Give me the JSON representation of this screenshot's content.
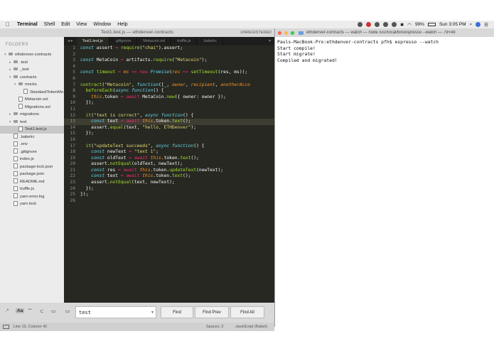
{
  "menubar": {
    "app": "Terminal",
    "items": [
      "Shell",
      "Edit",
      "View",
      "Window",
      "Help"
    ],
    "battery": "99%",
    "clock": "Sun 3:05 PM"
  },
  "editor": {
    "window_title": "Test1.test.js — ethdenver-contracts",
    "badge": "UNREGISTERED",
    "tabs": [
      "Test1.test.js",
      ".gitignore",
      "Metacoin.sol",
      "truffle.js",
      ".babelrc"
    ],
    "sidebar_header": "FOLDERS",
    "tree": [
      {
        "label": "ethdenver-contracts",
        "depth": 0,
        "kind": "folder",
        "open": true
      },
      {
        "label": ".test",
        "depth": 1,
        "kind": "folder"
      },
      {
        "label": "_test",
        "depth": 1,
        "kind": "folder"
      },
      {
        "label": "contracts",
        "depth": 1,
        "kind": "folder",
        "open": true
      },
      {
        "label": "mocks",
        "depth": 2,
        "kind": "folder",
        "open": true
      },
      {
        "label": "StandardTokenMo",
        "depth": 3,
        "kind": "file"
      },
      {
        "label": "Metacoin.sol",
        "depth": 2,
        "kind": "file"
      },
      {
        "label": "Migrations.sol",
        "depth": 2,
        "kind": "file"
      },
      {
        "label": "migrations",
        "depth": 1,
        "kind": "folder"
      },
      {
        "label": "test",
        "depth": 1,
        "kind": "folder",
        "open": true
      },
      {
        "label": "Test1.test.js",
        "depth": 2,
        "kind": "file",
        "selected": true
      },
      {
        "label": ".babelrc",
        "depth": 1,
        "kind": "file"
      },
      {
        "label": ".env",
        "depth": 1,
        "kind": "file"
      },
      {
        "label": ".gitignore",
        "depth": 1,
        "kind": "file"
      },
      {
        "label": "index.js",
        "depth": 1,
        "kind": "file"
      },
      {
        "label": "package-lock.json",
        "depth": 1,
        "kind": "file"
      },
      {
        "label": "package.json",
        "depth": 1,
        "kind": "file"
      },
      {
        "label": "README.md",
        "depth": 1,
        "kind": "file"
      },
      {
        "label": "truffle.js",
        "depth": 1,
        "kind": "file"
      },
      {
        "label": "yarn-error.log",
        "depth": 1,
        "kind": "file"
      },
      {
        "label": "yarn.lock",
        "depth": 1,
        "kind": "file"
      }
    ],
    "current_line": 13,
    "code_lines": [
      [
        [
          "kw",
          "const"
        ],
        [
          "t",
          " assert "
        ],
        [
          "red",
          "="
        ],
        [
          "t",
          " "
        ],
        [
          "fn",
          "require"
        ],
        [
          "t",
          "("
        ],
        [
          "str",
          "\"chai\""
        ],
        [
          "t",
          ").assert;"
        ]
      ],
      [],
      [
        [
          "kw",
          "const"
        ],
        [
          "t",
          " MetaCoin "
        ],
        [
          "red",
          "="
        ],
        [
          "t",
          " artifacts."
        ],
        [
          "fn",
          "require"
        ],
        [
          "t",
          "("
        ],
        [
          "str",
          "\"Metacoin\""
        ],
        [
          "t",
          ");"
        ]
      ],
      [],
      [
        [
          "kw",
          "const"
        ],
        [
          "t",
          " "
        ],
        [
          "fn",
          "timeout"
        ],
        [
          "t",
          " "
        ],
        [
          "red",
          "="
        ],
        [
          "t",
          " "
        ],
        [
          "prm",
          "ms"
        ],
        [
          "t",
          " "
        ],
        [
          "red",
          "=>"
        ],
        [
          "t",
          " "
        ],
        [
          "red",
          "new"
        ],
        [
          "t",
          " "
        ],
        [
          "kw",
          "Promise"
        ],
        [
          "t",
          "("
        ],
        [
          "prm",
          "res"
        ],
        [
          "t",
          " "
        ],
        [
          "red",
          "=>"
        ],
        [
          "t",
          " "
        ],
        [
          "fn",
          "setTimeout"
        ],
        [
          "t",
          "(res, ms));"
        ]
      ],
      [],
      [
        [
          "fn",
          "contract"
        ],
        [
          "t",
          "("
        ],
        [
          "str",
          "\"Metacoin\""
        ],
        [
          "t",
          ", "
        ],
        [
          "kw",
          "function"
        ],
        [
          "t",
          "([_, "
        ],
        [
          "prm",
          "owner"
        ],
        [
          "t",
          ", "
        ],
        [
          "prm",
          "recipient"
        ],
        [
          "t",
          ", "
        ],
        [
          "prm",
          "anotherAcco"
        ]
      ],
      [
        [
          "t",
          "  "
        ],
        [
          "fn",
          "beforeEach"
        ],
        [
          "t",
          "("
        ],
        [
          "kw",
          "async"
        ],
        [
          "t",
          " "
        ],
        [
          "kw",
          "function"
        ],
        [
          "t",
          "() {"
        ]
      ],
      [
        [
          "t",
          "    "
        ],
        [
          "ths",
          "this"
        ],
        [
          "t",
          ".token "
        ],
        [
          "red",
          "="
        ],
        [
          "t",
          " "
        ],
        [
          "red",
          "await"
        ],
        [
          "t",
          " MetaCoin."
        ],
        [
          "fn",
          "new"
        ],
        [
          "t",
          "({ owner: owner });"
        ]
      ],
      [
        [
          "t",
          "  });"
        ]
      ],
      [],
      [
        [
          "t",
          "  "
        ],
        [
          "fn",
          "it"
        ],
        [
          "t",
          "("
        ],
        [
          "str",
          "\"text is correct\""
        ],
        [
          "t",
          ", "
        ],
        [
          "kw",
          "async"
        ],
        [
          "t",
          " "
        ],
        [
          "kw",
          "function"
        ],
        [
          "t",
          "() {"
        ]
      ],
      [
        [
          "t",
          "    "
        ],
        [
          "kw",
          "const"
        ],
        [
          "t",
          " text "
        ],
        [
          "red",
          "="
        ],
        [
          "t",
          " "
        ],
        [
          "red",
          "await"
        ],
        [
          "t",
          " "
        ],
        [
          "ths",
          "this"
        ],
        [
          "t",
          ".token."
        ],
        [
          "fn",
          "text"
        ],
        [
          "t",
          "();"
        ]
      ],
      [
        [
          "t",
          "    assert."
        ],
        [
          "fn",
          "equal"
        ],
        [
          "t",
          "(text, "
        ],
        [
          "str",
          "\"hello, ETHDenver\""
        ],
        [
          "t",
          ");"
        ]
      ],
      [
        [
          "t",
          "  });"
        ]
      ],
      [],
      [
        [
          "t",
          "  "
        ],
        [
          "fn",
          "it"
        ],
        [
          "t",
          "("
        ],
        [
          "str",
          "\"updateText succeeds\""
        ],
        [
          "t",
          ", "
        ],
        [
          "kw",
          "async"
        ],
        [
          "t",
          " "
        ],
        [
          "kw",
          "function"
        ],
        [
          "t",
          "() {"
        ]
      ],
      [
        [
          "t",
          "    "
        ],
        [
          "kw",
          "const"
        ],
        [
          "t",
          " newText "
        ],
        [
          "red",
          "="
        ],
        [
          "t",
          " "
        ],
        [
          "str",
          "\"text 1\""
        ],
        [
          "t",
          ";"
        ]
      ],
      [
        [
          "t",
          "    "
        ],
        [
          "kw",
          "const"
        ],
        [
          "t",
          " oldText "
        ],
        [
          "red",
          "="
        ],
        [
          "t",
          " "
        ],
        [
          "red",
          "await"
        ],
        [
          "t",
          " "
        ],
        [
          "ths",
          "this"
        ],
        [
          "t",
          ".token."
        ],
        [
          "fn",
          "text"
        ],
        [
          "t",
          "();"
        ]
      ],
      [
        [
          "t",
          "    assert."
        ],
        [
          "fn",
          "notEqual"
        ],
        [
          "t",
          "(oldText, newText);"
        ]
      ],
      [
        [
          "t",
          "    "
        ],
        [
          "kw",
          "const"
        ],
        [
          "t",
          " res "
        ],
        [
          "red",
          "="
        ],
        [
          "t",
          " "
        ],
        [
          "red",
          "await"
        ],
        [
          "t",
          " "
        ],
        [
          "ths",
          "this"
        ],
        [
          "t",
          ".token."
        ],
        [
          "fn",
          "updateText"
        ],
        [
          "t",
          "(newText);"
        ]
      ],
      [
        [
          "t",
          "    "
        ],
        [
          "kw",
          "const"
        ],
        [
          "t",
          " text "
        ],
        [
          "red",
          "="
        ],
        [
          "t",
          " "
        ],
        [
          "red",
          "await"
        ],
        [
          "t",
          " "
        ],
        [
          "ths",
          "this"
        ],
        [
          "t",
          ".token."
        ],
        [
          "fn",
          "text"
        ],
        [
          "t",
          "();"
        ]
      ],
      [
        [
          "t",
          "    assert."
        ],
        [
          "fn",
          "notEqual"
        ],
        [
          "t",
          "(text, newText);"
        ]
      ],
      [
        [
          "t",
          "  });"
        ]
      ],
      [
        [
          "t",
          "});"
        ]
      ],
      []
    ],
    "find": {
      "value": "test",
      "find_label": "Find",
      "find_prev_label": "Find Prev",
      "find_all_label": "Find All",
      "opt_regex": ".*",
      "opt_case": "Aa",
      "opt_word": "\"\"",
      "opt_wrap": "⊂",
      "opt_sel": "▭"
    },
    "status": {
      "position": "Line 13, Column 42",
      "spaces": "Spaces: 2",
      "syntax": "JavaScript (Babel)"
    }
  },
  "terminal": {
    "title": "ethdenver-contracts — watch — node /usr/local/bin/espresso --watch — 79×49",
    "lines": [
      "Pauls-MacBook-Pro:ethdenver-contracts pfh$ espresso --watch",
      "Start compile!",
      "Start migrate!",
      "Compiled and migrated!"
    ]
  }
}
